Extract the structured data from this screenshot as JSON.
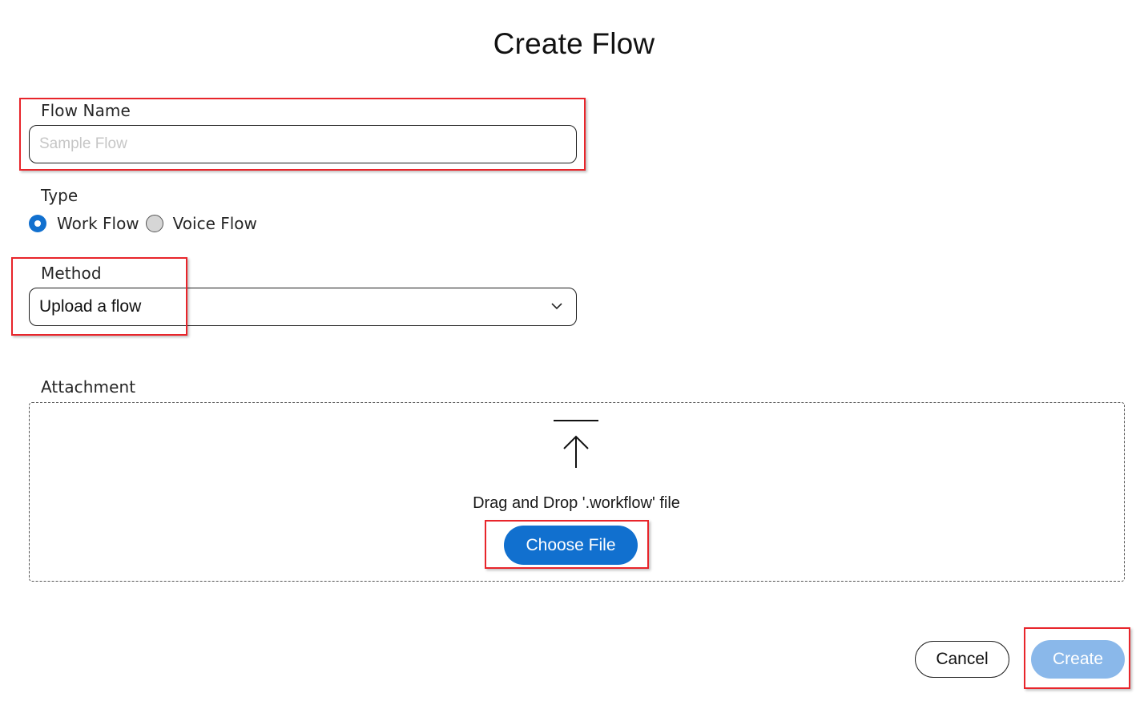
{
  "dialog": {
    "title": "Create Flow"
  },
  "flow_name": {
    "label": "Flow Name",
    "value": "",
    "placeholder": "Sample Flow"
  },
  "type": {
    "label": "Type",
    "options": [
      {
        "label": "Work Flow",
        "selected": true
      },
      {
        "label": "Voice Flow",
        "selected": false
      }
    ]
  },
  "method": {
    "label": "Method",
    "selected_value": "Upload a flow"
  },
  "attachment": {
    "label": "Attachment",
    "drop_text": "Drag and Drop '.workflow' file",
    "choose_label": "Choose File",
    "icon": "upload-icon"
  },
  "footer": {
    "cancel_label": "Cancel",
    "create_label": "Create",
    "create_disabled": true
  },
  "colors": {
    "accent": "#1170cf",
    "disabled_primary": "#8ab8ea",
    "highlight": "#e8252b"
  }
}
